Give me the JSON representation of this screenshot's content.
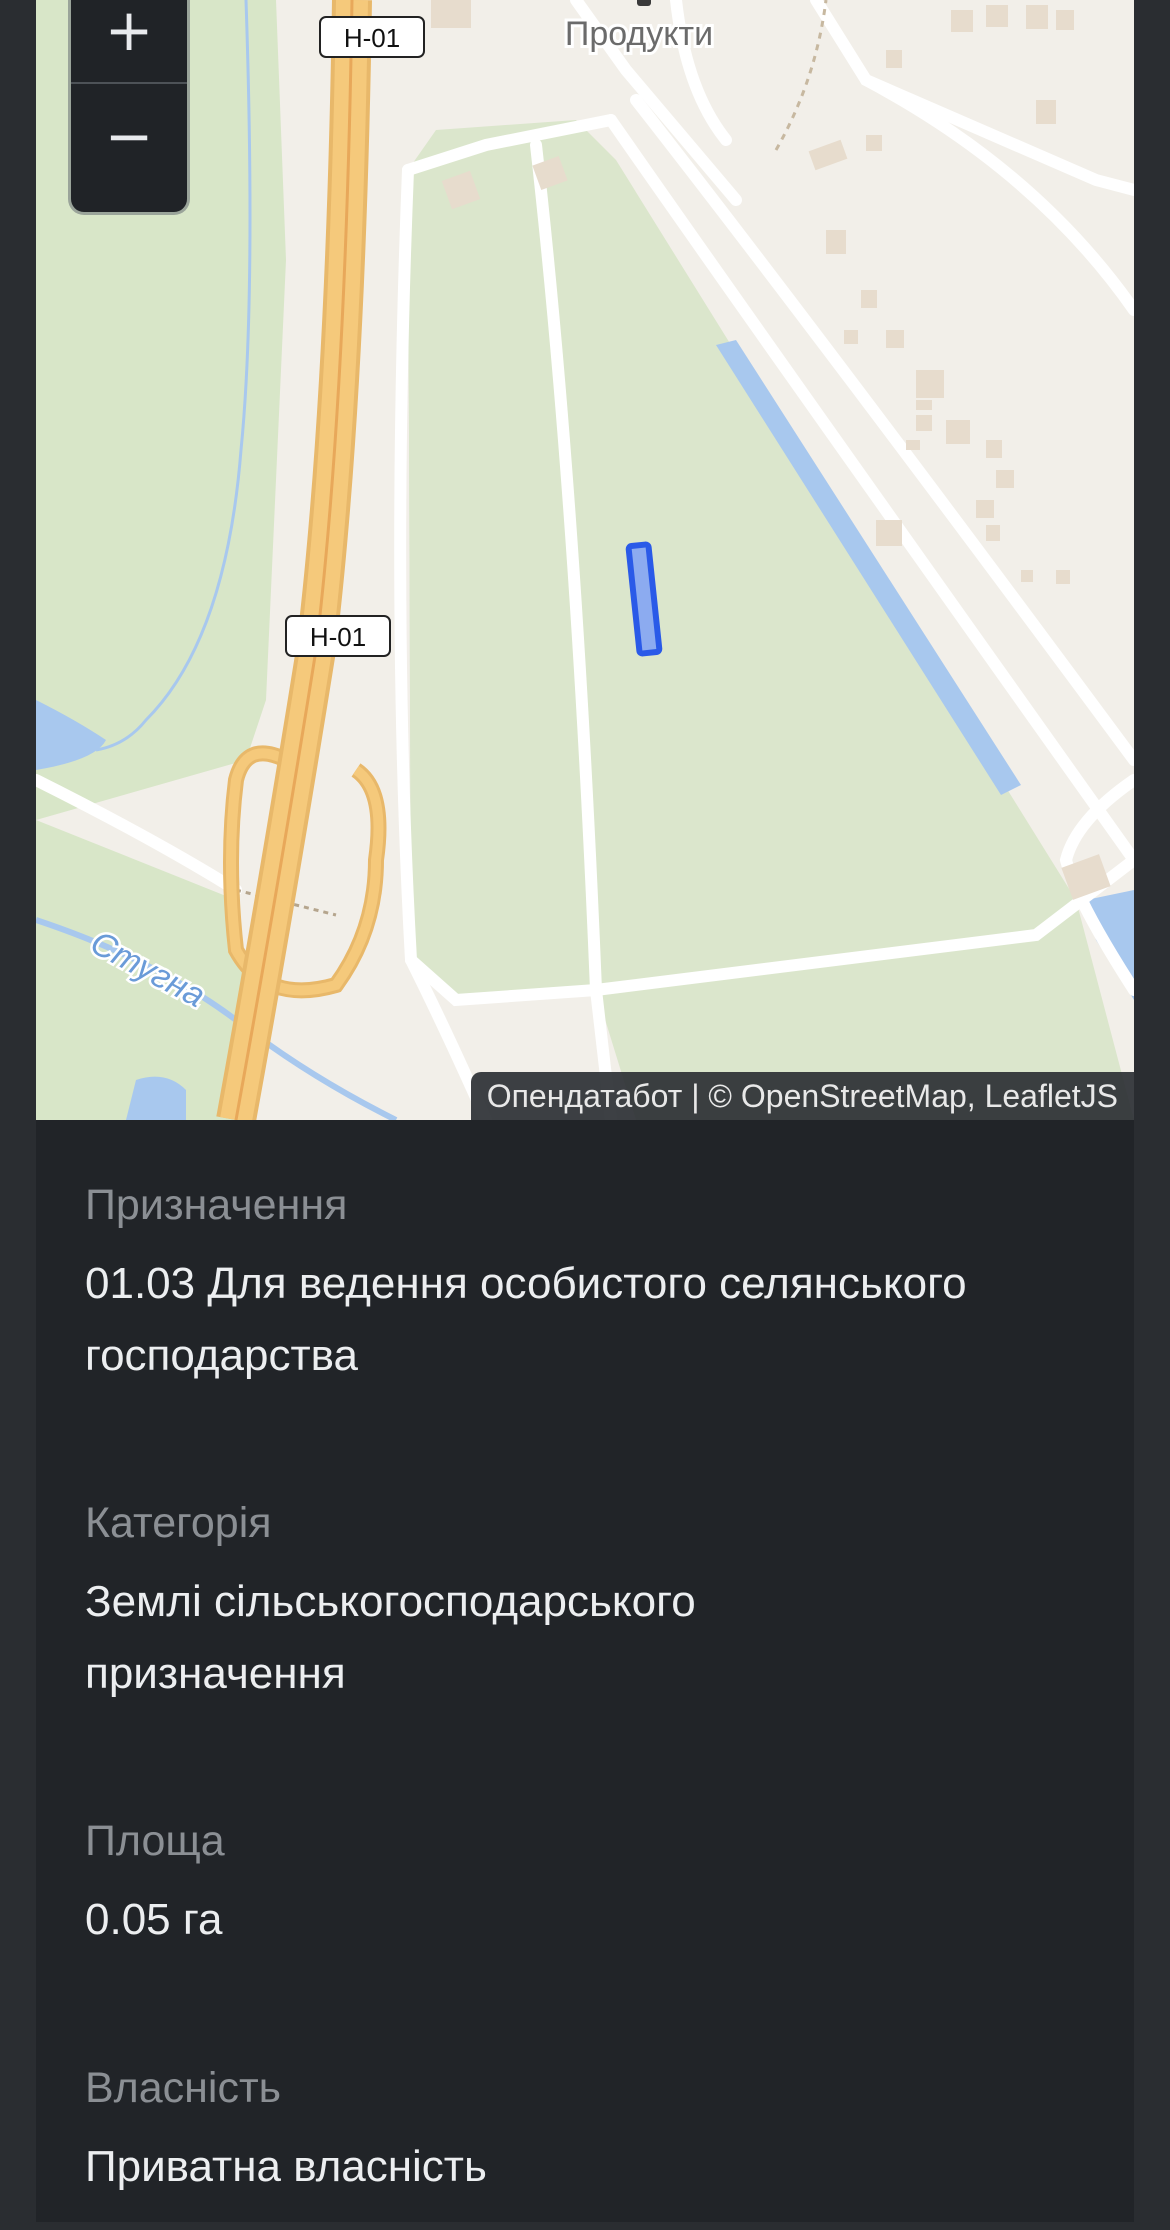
{
  "map": {
    "zoom_in_label": "+",
    "zoom_out_label": "−",
    "poi_label": "Продукти",
    "road_shield_top": "Н-01",
    "road_shield_mid": "Н-01",
    "river_label": "Стугна",
    "attribution": "Опендатабот | © OpenStreetMap, LeafletJS",
    "colors": {
      "background": "#f2efe9",
      "meadow": "#dbe6cc",
      "forest_light": "#d8e6c8",
      "water": "#a8c8ee",
      "highway": "#f5c97b",
      "parcel": "#2a5ae8"
    }
  },
  "fields": [
    {
      "label": "Призначення",
      "value": "01.03 Для ведення особистого селянського господарства"
    },
    {
      "label": "Категорія",
      "value": "Землі сільськогосподарського призначення"
    },
    {
      "label": "Площа",
      "value": "0.05 га"
    },
    {
      "label": "Власність",
      "value": "Приватна власність"
    }
  ]
}
